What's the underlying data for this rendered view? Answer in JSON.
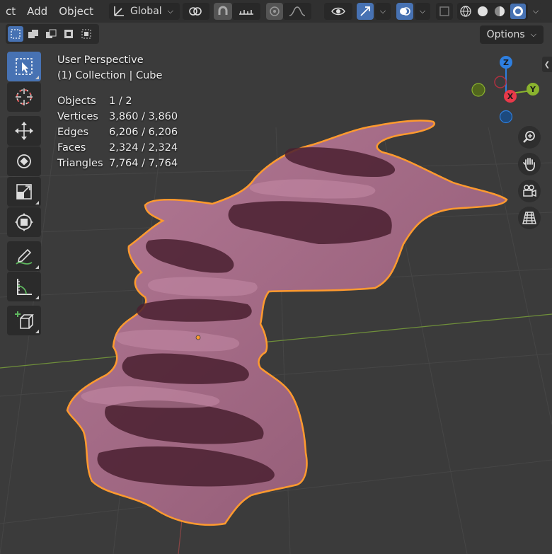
{
  "header": {
    "menu": [
      "ct",
      "Add",
      "Object"
    ],
    "transform_orientation": "Global"
  },
  "subheader": {
    "options_label": "Options"
  },
  "overlay": {
    "perspective": "User Perspective",
    "collection": "(1) Collection | Cube",
    "stats": [
      {
        "label": "Objects",
        "value": "1 / 2"
      },
      {
        "label": "Vertices",
        "value": "3,860 / 3,860"
      },
      {
        "label": "Edges",
        "value": "6,206 / 6,206"
      },
      {
        "label": "Faces",
        "value": "2,324 / 2,324"
      },
      {
        "label": "Triangles",
        "value": "7,764 / 7,764"
      }
    ]
  },
  "gizmo": {
    "x": "X",
    "y": "Y",
    "z": "Z"
  },
  "colors": {
    "mesh": "#a36a86",
    "outline": "#ff9a2e",
    "accent": "#4772b3",
    "x_axis": "#e8394a",
    "y_axis": "#8ab32e",
    "z_axis": "#2e7fe0"
  },
  "tools": [
    "select-box-tool",
    "cursor-tool",
    "move-tool",
    "rotate-tool",
    "scale-tool",
    "transform-tool",
    "annotate-tool",
    "measure-tool",
    "add-cube-tool"
  ],
  "nav": [
    "zoom-icon",
    "hand-icon",
    "camera-icon",
    "grid-icon"
  ]
}
